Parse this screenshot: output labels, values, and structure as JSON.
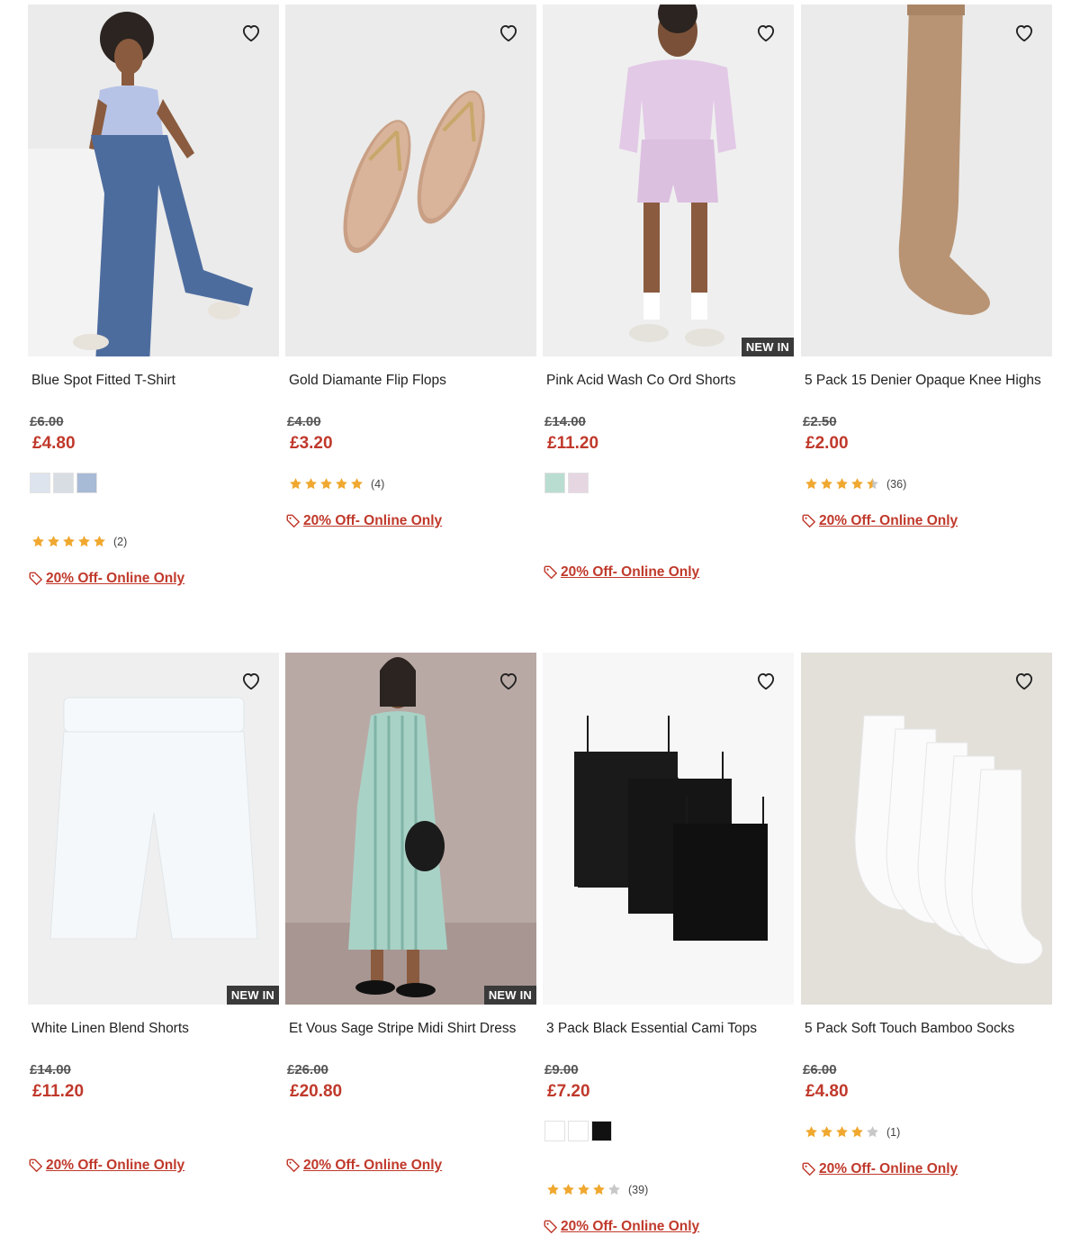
{
  "badges": {
    "new_in": "NEW IN"
  },
  "colors": {
    "sale_price": "#c0392b",
    "star": "#f0a830",
    "star_empty": "#c8c8c8"
  },
  "products": [
    {
      "title": "Blue Spot Fitted T-Shirt",
      "was_price": "£6.00",
      "now_price": "£4.80",
      "swatches": [
        "#dde4ee",
        "#d8dde4",
        "#a7bad6"
      ],
      "rating": 5,
      "review_count": "(2)",
      "promo": "20% Off- Online Only",
      "new_in": false,
      "image": "model-tshirt-jeans"
    },
    {
      "title": "Gold Diamante Flip Flops",
      "was_price": "£4.00",
      "now_price": "£3.20",
      "swatches": [],
      "rating": 5,
      "review_count": "(4)",
      "promo": "20% Off- Online Only",
      "new_in": false,
      "image": "flip-flops"
    },
    {
      "title": "Pink Acid Wash Co Ord Shorts",
      "was_price": "£14.00",
      "now_price": "£11.20",
      "swatches": [
        "#b9ddd0",
        "#e6d6e2"
      ],
      "rating": null,
      "review_count": "",
      "promo": "20% Off- Online Only",
      "new_in": true,
      "image": "model-pink-shorts"
    },
    {
      "title": "5 Pack 15 Denier Opaque Knee Highs",
      "was_price": "£2.50",
      "now_price": "£2.00",
      "swatches": [],
      "rating": 4.5,
      "review_count": "(36)",
      "promo": "20% Off- Online Only",
      "new_in": false,
      "image": "knee-high"
    },
    {
      "title": "White Linen Blend Shorts",
      "was_price": "£14.00",
      "now_price": "£11.20",
      "swatches": [],
      "rating": null,
      "review_count": "",
      "promo": "20% Off- Online Only",
      "new_in": true,
      "image": "white-shorts"
    },
    {
      "title": "Et Vous Sage Stripe Midi Shirt Dress",
      "was_price": "£26.00",
      "now_price": "£20.80",
      "swatches": [],
      "rating": null,
      "review_count": "",
      "promo": "20% Off- Online Only",
      "new_in": true,
      "image": "model-dress"
    },
    {
      "title": "3 Pack Black Essential Cami Tops",
      "was_price": "£9.00",
      "now_price": "£7.20",
      "swatches": [
        "#ffffff",
        "#ffffff",
        "#111111"
      ],
      "rating": 4,
      "review_count": "(39)",
      "promo": "20% Off- Online Only",
      "new_in": false,
      "image": "cami-tops"
    },
    {
      "title": "5 Pack Soft Touch Bamboo Socks",
      "was_price": "£6.00",
      "now_price": "£4.80",
      "swatches": [],
      "rating": 4,
      "review_count": "(1)",
      "promo": "20% Off- Online Only",
      "new_in": false,
      "image": "white-socks"
    }
  ]
}
